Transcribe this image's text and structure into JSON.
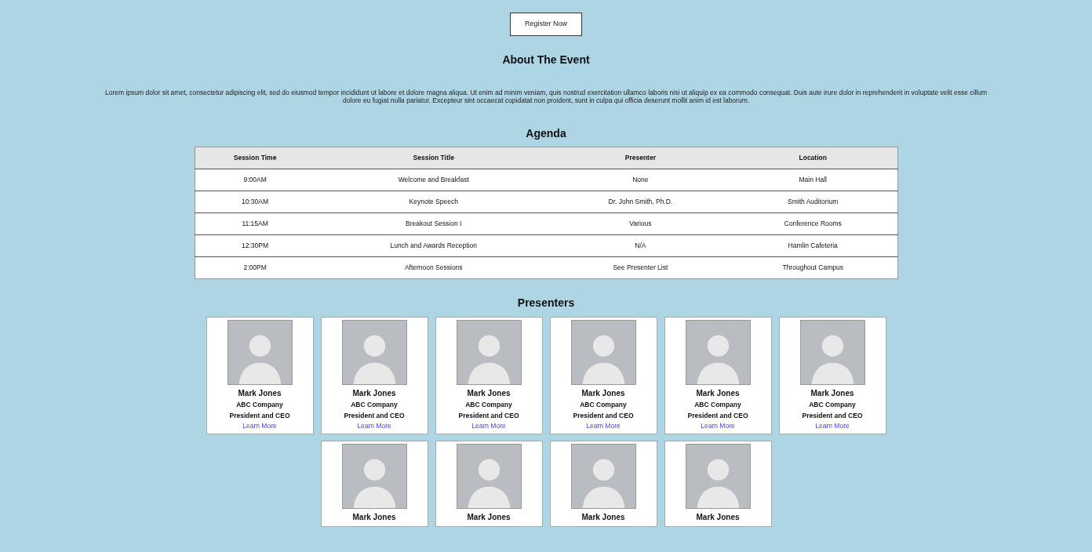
{
  "register_button": {
    "label": "Register Now"
  },
  "about": {
    "heading": "About The Event",
    "text": "Lorem ipsum dolor sit amet, consectetur adipiscing elit, sed do eiusmod tempor incididunt ut labore et dolore magna aliqua. Ut enim ad minim veniam, quis nostrud exercitation ullamco laboris nisi ut aliquip ex ea commodo consequat. Duis aute irure dolor in reprehenderit in voluptate velit esse cillum dolore eu fugiat nulla pariatur. Excepteur sint occaecat cupidatat non proident, sunt in culpa qui officia deserunt mollit anim id est laborum."
  },
  "agenda": {
    "heading": "Agenda",
    "columns": [
      "Session Time",
      "Session Title",
      "Presenter",
      "Location"
    ],
    "rows": [
      [
        "9:00AM",
        "Welcome and Breakfast",
        "None",
        "Main Hall"
      ],
      [
        "10:30AM",
        "Keynote Speech",
        "Dr. John Smith, Ph.D.",
        "Smith Auditorium"
      ],
      [
        "11:15AM",
        "Breakout Session I",
        "Various",
        "Conference Rooms"
      ],
      [
        "12:30PM",
        "Lunch and Awards Reception",
        "N/A",
        "Hamlin Cafeteria"
      ],
      [
        "2:00PM",
        "Afternoon Sessions",
        "See Presenter List",
        "Throughout Campus"
      ]
    ]
  },
  "presenters": {
    "heading": "Presenters",
    "items": [
      {
        "name": "Mark Jones",
        "company": "ABC Company",
        "title": "President and CEO",
        "link": "Learn More"
      },
      {
        "name": "Mark Jones",
        "company": "ABC Company",
        "title": "President and CEO",
        "link": "Learn More"
      },
      {
        "name": "Mark Jones",
        "company": "ABC Company",
        "title": "President and CEO",
        "link": "Learn More"
      },
      {
        "name": "Mark Jones",
        "company": "ABC Company",
        "title": "President and CEO",
        "link": "Learn More"
      },
      {
        "name": "Mark Jones",
        "company": "ABC Company",
        "title": "President and CEO",
        "link": "Learn More"
      },
      {
        "name": "Mark Jones",
        "company": "ABC Company",
        "title": "President and CEO",
        "link": "Learn More"
      },
      {
        "name": "Mark Jones"
      },
      {
        "name": "Mark Jones"
      },
      {
        "name": "Mark Jones"
      },
      {
        "name": "Mark Jones"
      }
    ]
  }
}
